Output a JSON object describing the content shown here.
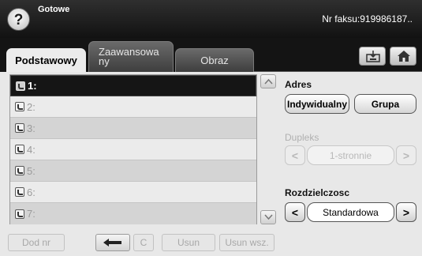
{
  "header": {
    "help_label": "?",
    "status": "Gotowe",
    "fax_number": "Nr faksu:919986187.."
  },
  "tabs": [
    {
      "label": "Podstawowy",
      "active": true
    },
    {
      "label_line1": "Zaawansowa",
      "label_line2": "ny",
      "active": false
    },
    {
      "label": "Obraz",
      "active": false
    }
  ],
  "toolbar_icons": [
    "tray-icon",
    "home-icon"
  ],
  "number_list": {
    "selected_index": 0,
    "rows": [
      "1:",
      "2:",
      "3:",
      "4:",
      "5:",
      "6:",
      "7:"
    ]
  },
  "bottom_buttons": {
    "add_number": "Dod nr",
    "backspace_icon": "back-arrow-icon",
    "clear": "C",
    "delete": "Usun",
    "delete_all": "Usun wsz."
  },
  "address": {
    "label": "Adres",
    "individual": "Indywidualny",
    "group": "Grupa"
  },
  "duplex": {
    "label": "Dupleks",
    "value": "1-stronnie",
    "enabled": false
  },
  "resolution": {
    "label": "Rozdzielczosc",
    "value": "Standardowa",
    "enabled": true
  },
  "arrows": {
    "left": "<",
    "right": ">"
  }
}
